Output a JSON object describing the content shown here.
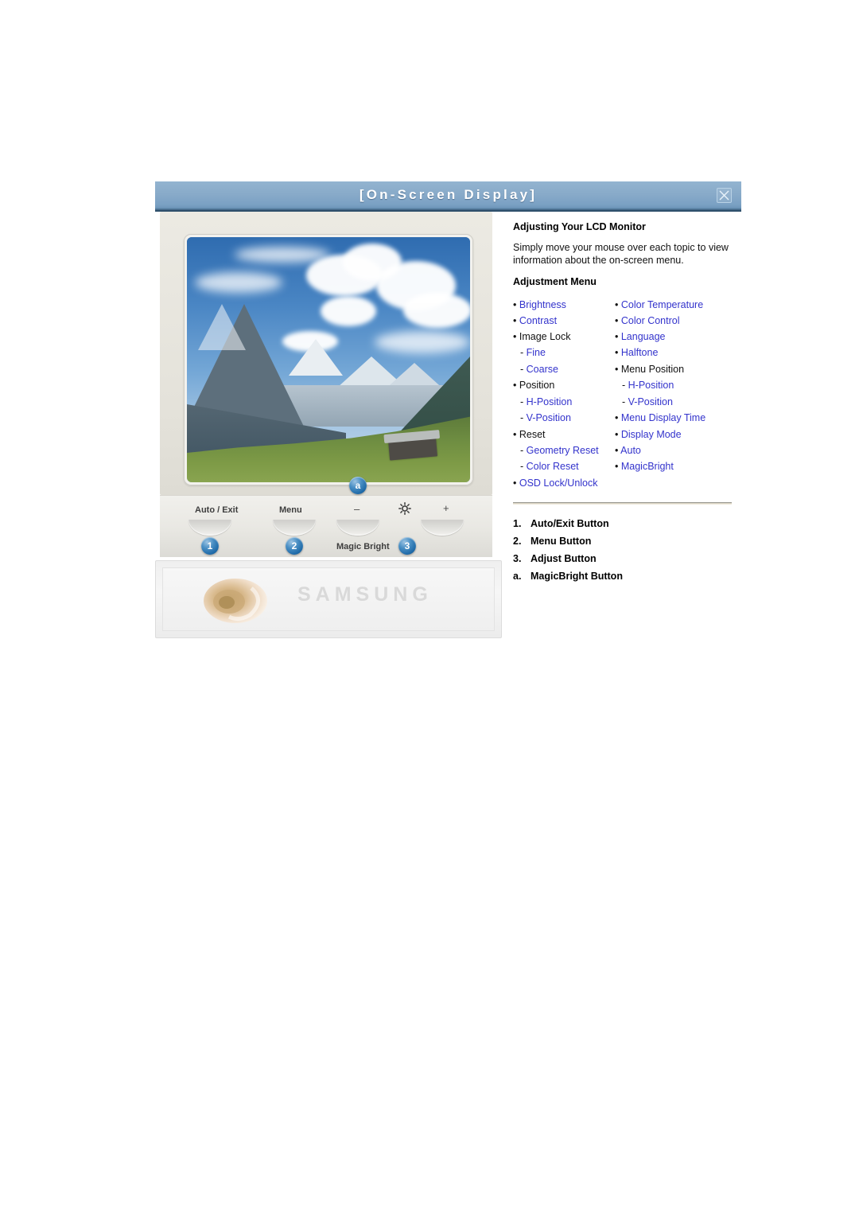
{
  "window": {
    "title": "[On-Screen Display]",
    "close_icon": "close-icon"
  },
  "colors": {
    "titlebar_blue": "#88aac9",
    "titlebar_edge": "#2e4f6b",
    "link_blue": "#3333cc",
    "badge_blue": "#1f6aa8",
    "bezel": "#e6e4dc",
    "text": "#111111"
  },
  "content": {
    "heading": "Adjusting Your LCD Monitor",
    "intro": "Simply move your mouse over each topic to view information about the on-screen menu.",
    "subheading": "Adjustment Menu"
  },
  "menu": {
    "left": [
      {
        "label": "Brightness",
        "bullet": "•",
        "link": true,
        "sub": false
      },
      {
        "label": "Contrast",
        "bullet": "•",
        "link": true,
        "sub": false
      },
      {
        "label": "Image Lock",
        "bullet": "•",
        "link": false,
        "sub": false
      },
      {
        "label": "Fine",
        "bullet": "-",
        "link": true,
        "sub": true
      },
      {
        "label": "Coarse",
        "bullet": "-",
        "link": true,
        "sub": true
      },
      {
        "label": "Position",
        "bullet": "•",
        "link": false,
        "sub": false
      },
      {
        "label": "H-Position",
        "bullet": "-",
        "link": true,
        "sub": true
      },
      {
        "label": "V-Position",
        "bullet": "-",
        "link": true,
        "sub": true
      },
      {
        "label": "Reset",
        "bullet": "•",
        "link": false,
        "sub": false
      },
      {
        "label": "Geometry Reset",
        "bullet": "-",
        "link": true,
        "sub": true
      },
      {
        "label": "Color Reset",
        "bullet": "-",
        "link": true,
        "sub": true
      },
      {
        "label": "OSD Lock/Unlock",
        "bullet": "•",
        "link": true,
        "sub": false
      }
    ],
    "right": [
      {
        "label": "Color Temperature",
        "bullet": "•",
        "link": true,
        "sub": false
      },
      {
        "label": "Color Control",
        "bullet": "•",
        "link": true,
        "sub": false
      },
      {
        "label": "Language",
        "bullet": "•",
        "link": true,
        "sub": false
      },
      {
        "label": "Halftone",
        "bullet": "•",
        "link": true,
        "sub": false
      },
      {
        "label": "Menu Position",
        "bullet": "•",
        "link": false,
        "sub": false
      },
      {
        "label": "H-Position",
        "bullet": "-",
        "link": true,
        "sub": true
      },
      {
        "label": "V-Position",
        "bullet": "-",
        "link": true,
        "sub": true
      },
      {
        "label": "Menu Display Time",
        "bullet": "•",
        "link": true,
        "sub": false
      },
      {
        "label": "Display Mode",
        "bullet": "•",
        "link": true,
        "sub": false
      },
      {
        "label": "Auto",
        "bullet": "•",
        "link": true,
        "sub": false
      },
      {
        "label": "MagicBright",
        "bullet": "•",
        "link": true,
        "sub": false
      },
      {
        "label": "",
        "bullet": "",
        "link": false,
        "sub": false
      }
    ]
  },
  "legend": [
    {
      "num": "1.",
      "label": "Auto/Exit Button"
    },
    {
      "num": "2.",
      "label": "Menu Button"
    },
    {
      "num": "3.",
      "label": "Adjust Button"
    },
    {
      "num": "a.",
      "label": "MagicBright Button"
    }
  ],
  "monitor": {
    "buttons": [
      {
        "label": "Auto / Exit",
        "badge": "1"
      },
      {
        "label": "Menu",
        "badge": "2"
      },
      {
        "label": "–",
        "badge": "a"
      },
      {
        "label": "+",
        "badge": "3"
      }
    ],
    "magicbright_label": "Magic Bright",
    "brightness_icon": "sun-icon",
    "brand": "SAMSUNG",
    "shell_icon": "nautilus-shell-icon",
    "screen_image": "mountain-landscape-photo"
  }
}
